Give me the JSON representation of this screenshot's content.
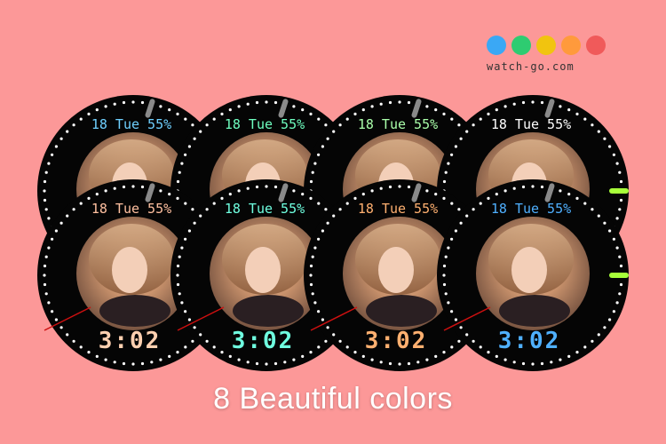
{
  "brand": {
    "name": "watch-go.com",
    "dot_colors": [
      "#3aa8f5",
      "#2ecc71",
      "#f1c40f",
      "#ff9a3c",
      "#f05a5a"
    ]
  },
  "caption": "8 Beautiful colors",
  "watch": {
    "date_text": "18 Tue 55%",
    "time_text": "3:02",
    "photo": "woman portrait",
    "marker_color": "#a8ff3a",
    "hand_color": "#cc1010"
  },
  "watch_variants": [
    {
      "row": "back",
      "date_color": "#6fd0ff",
      "time_color": "#9ad0ff"
    },
    {
      "row": "back",
      "date_color": "#6fffc0",
      "time_color": "#6fffc0"
    },
    {
      "row": "back",
      "date_color": "#aaffaa",
      "time_color": "#ffd27a"
    },
    {
      "row": "back",
      "date_color": "#ffffff",
      "time_color": "#ffb0ff"
    },
    {
      "row": "front",
      "date_color": "#ffc0a0",
      "time_color": "#ffd0b0"
    },
    {
      "row": "front",
      "date_color": "#6fffe0",
      "time_color": "#6fffe0"
    },
    {
      "row": "front",
      "date_color": "#ffb070",
      "time_color": "#ffb070"
    },
    {
      "row": "front",
      "date_color": "#4fb0ff",
      "time_color": "#4fb0ff"
    }
  ]
}
